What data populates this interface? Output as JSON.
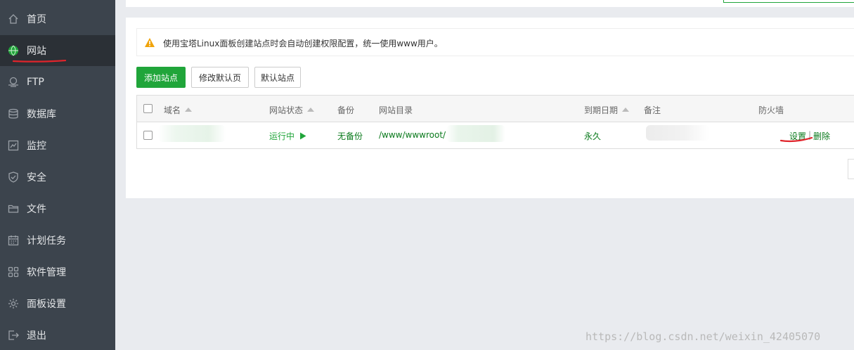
{
  "sidebar": {
    "items": [
      {
        "label": "首页",
        "icon": "home-icon"
      },
      {
        "label": "网站",
        "icon": "globe-icon",
        "active": true
      },
      {
        "label": "FTP",
        "icon": "ftp-icon"
      },
      {
        "label": "数据库",
        "icon": "database-icon"
      },
      {
        "label": "监控",
        "icon": "monitor-icon"
      },
      {
        "label": "安全",
        "icon": "shield-icon"
      },
      {
        "label": "文件",
        "icon": "folder-icon"
      },
      {
        "label": "计划任务",
        "icon": "calendar-icon"
      },
      {
        "label": "软件管理",
        "icon": "apps-grid-icon"
      },
      {
        "label": "面板设置",
        "icon": "gear-icon"
      },
      {
        "label": "退出",
        "icon": "logout-icon"
      }
    ]
  },
  "notice": {
    "text": "使用宝塔Linux面板创建站点时会自动创建权限配置，统一使用www用户。",
    "icon": "warning-icon"
  },
  "toolbar": {
    "add_site": "添加站点",
    "edit_default_page": "修改默认页",
    "default_site": "默认站点"
  },
  "table": {
    "headers": {
      "domain": "域名",
      "status": "网站状态",
      "backup": "备份",
      "directory": "网站目录",
      "expiry": "到期日期",
      "remark": "备注",
      "firewall": "防火墙"
    },
    "rows": [
      {
        "domain": "",
        "status": "运行中",
        "backup": "无备份",
        "directory": "/www/wwwroot/",
        "expiry": "永久",
        "remark": "",
        "actions": {
          "settings": "设置",
          "separator": "|",
          "delete": "删除"
        }
      }
    ]
  },
  "colors": {
    "accent": "#20a53a",
    "sidebar_bg": "#3c444d",
    "sidebar_active": "#2b3036",
    "warning": "#f0a30a"
  },
  "watermark": "https://blog.csdn.net/weixin_42405070"
}
